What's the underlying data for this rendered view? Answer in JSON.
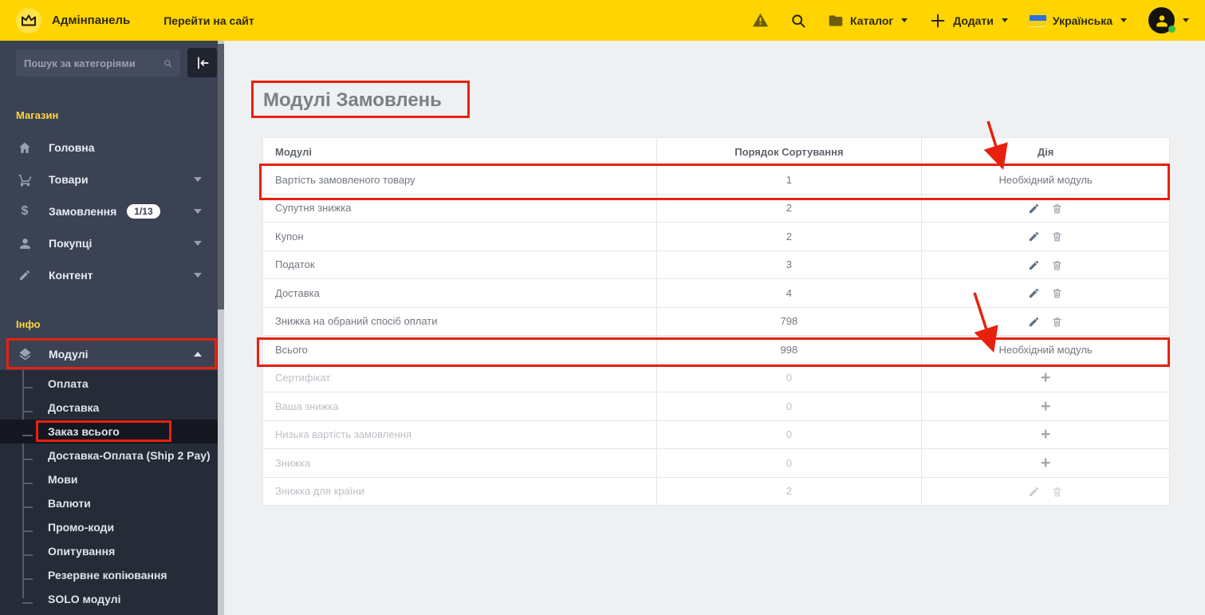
{
  "topbar": {
    "brand": "Адмінпанель",
    "go_to_site": "Перейти на сайт",
    "catalog_label": "Каталог",
    "add_label": "Додати",
    "language_label": "Українська"
  },
  "sidebar": {
    "search_placeholder": "Пошук за категоріями",
    "sections": [
      {
        "header": "Магазин",
        "items": [
          {
            "id": "home",
            "label": "Головна",
            "icon": "home-icon",
            "caret": "none"
          },
          {
            "id": "products",
            "label": "Товари",
            "icon": "cart-icon",
            "caret": "down"
          },
          {
            "id": "orders",
            "label": "Замовлення",
            "icon": "dollar-icon",
            "caret": "down",
            "badge": "1/13"
          },
          {
            "id": "customers",
            "label": "Покупці",
            "icon": "users-icon",
            "caret": "down"
          },
          {
            "id": "content",
            "label": "Контент",
            "icon": "pencil-icon",
            "caret": "down"
          }
        ]
      },
      {
        "header": "Інфо",
        "items": [
          {
            "id": "modules",
            "label": "Модулі",
            "icon": "layers-icon",
            "caret": "up",
            "expanded": true,
            "annotated": true
          }
        ]
      }
    ],
    "submenu": [
      {
        "id": "payment",
        "label": "Оплата"
      },
      {
        "id": "shipping",
        "label": "Доставка"
      },
      {
        "id": "order-total",
        "label": "Заказ всього",
        "selected": true,
        "annotated": true
      },
      {
        "id": "ship2pay",
        "label": "Доставка-Оплата (Ship 2 Pay)"
      },
      {
        "id": "languages",
        "label": "Мови"
      },
      {
        "id": "currencies",
        "label": "Валюти"
      },
      {
        "id": "promo-codes",
        "label": "Промо-коди"
      },
      {
        "id": "surveys",
        "label": "Опитування"
      },
      {
        "id": "backup",
        "label": "Резервне копіювання"
      },
      {
        "id": "solo-modules",
        "label": "SOLO модулі"
      }
    ]
  },
  "main": {
    "title": "Модулі Замовлень",
    "table": {
      "columns": [
        "Модулі",
        "Порядок Сортування",
        "Дія"
      ],
      "required_label": "Необхідний модуль",
      "rows": [
        {
          "module": "Вартість замовленого товару",
          "sort_order": "1",
          "action": "required",
          "annotated": true
        },
        {
          "module": "Супутня знижка",
          "sort_order": "2",
          "action": "edit-delete"
        },
        {
          "module": "Купон",
          "sort_order": "2",
          "action": "edit-delete"
        },
        {
          "module": "Податок",
          "sort_order": "3",
          "action": "edit-delete"
        },
        {
          "module": "Доставка",
          "sort_order": "4",
          "action": "edit-delete"
        },
        {
          "module": "Знижка на обраний спосіб оплати",
          "sort_order": "798",
          "action": "edit-delete"
        },
        {
          "module": "Всього",
          "sort_order": "998",
          "action": "required",
          "annotated": true
        },
        {
          "module": "Сертифікат",
          "sort_order": "0",
          "action": "add",
          "disabled": true
        },
        {
          "module": "Ваша знижка",
          "sort_order": "0",
          "action": "add",
          "disabled": true
        },
        {
          "module": "Низька вартість замовлення",
          "sort_order": "0",
          "action": "add",
          "disabled": true
        },
        {
          "module": "Знижка",
          "sort_order": "0",
          "action": "add",
          "disabled": true
        },
        {
          "module": "Знижка для країни",
          "sort_order": "2",
          "action": "edit-delete",
          "disabled": true
        }
      ]
    }
  },
  "colors": {
    "topbar_yellow": "#ffd400",
    "sidebar_bg": "#3b4254",
    "submenu_bg": "#262b38",
    "section_header_yellow": "#ffd43b",
    "annotation_red": "#e8210e"
  }
}
